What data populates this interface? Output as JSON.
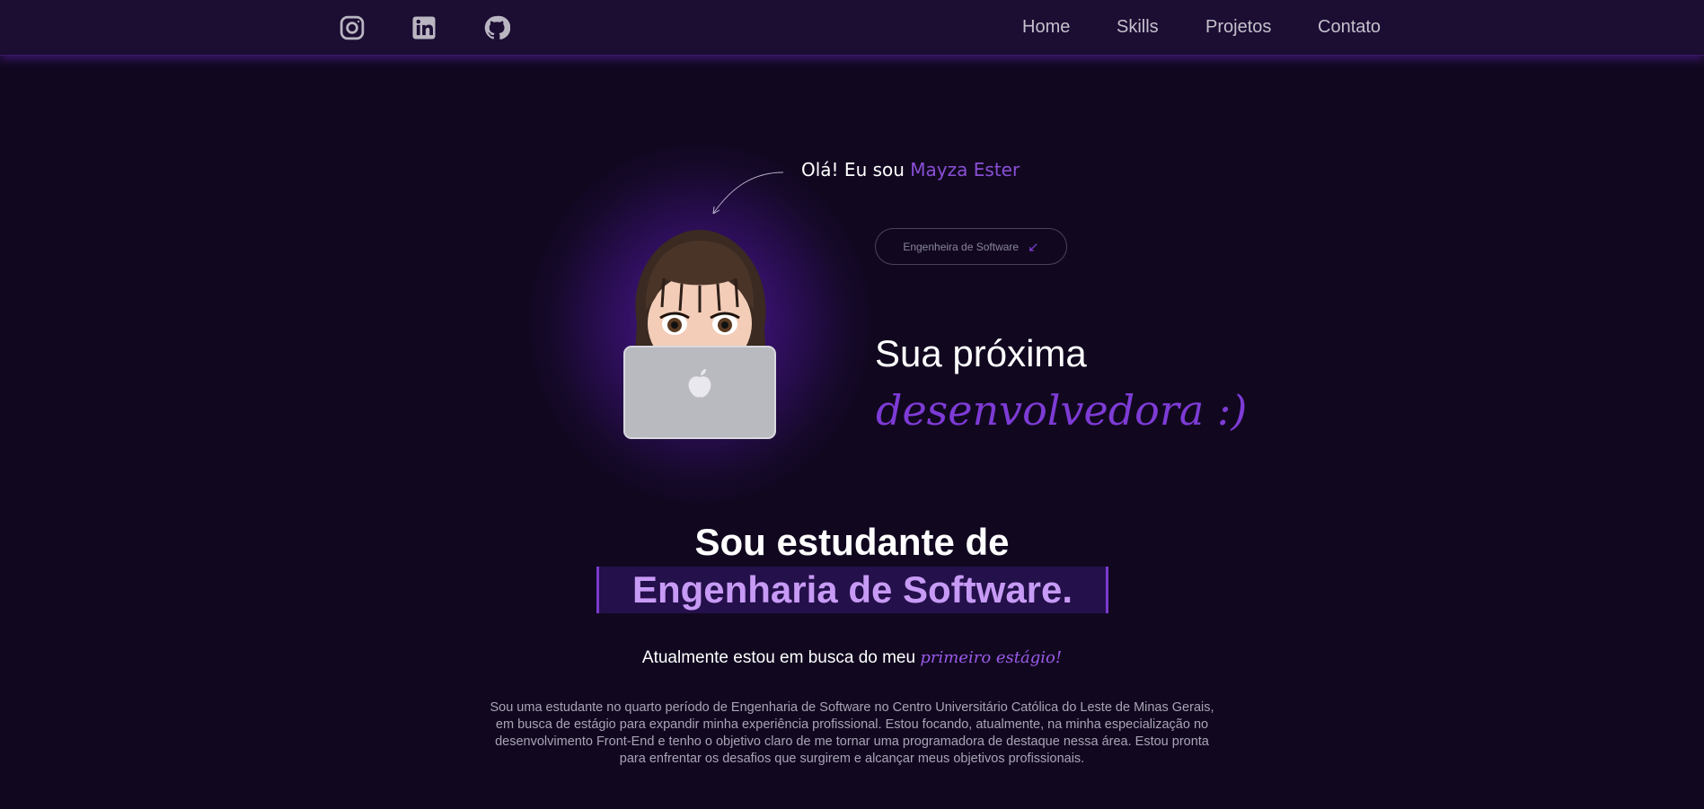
{
  "nav": {
    "social": [
      {
        "icon": "instagram-icon"
      },
      {
        "icon": "linkedin-icon"
      },
      {
        "icon": "github-icon"
      }
    ],
    "links": [
      "Home",
      "Skills",
      "Projetos",
      "Contato"
    ]
  },
  "hero": {
    "greeting_prefix": "Olá! Eu sou",
    "greeting_name": "Mayza Ester",
    "role_pill": "Engenheira de Software",
    "role_pill_icon": "arrow-down-left-icon",
    "tagline_line1": "Sua próxima",
    "tagline_line2": "desenvolvedora :)"
  },
  "intro": {
    "heading_line1": "Sou estudante de",
    "heading_line2": "Engenharia de Software.",
    "search_prefix": "Atualmente estou em busca do meu",
    "search_highlight": "primeiro estágio!",
    "bio_lines": [
      "Sou uma estudante no quarto período de Engenharia de Software no Centro Universitário Católica do Leste de Minas Gerais,",
      "em busca de estágio para expandir minha experiência profissional. Estou focando, atualmente, na minha especialização no",
      "desenvolvimento Front-End e tenho o objetivo claro de me tornar uma programadora de destaque nessa área. Estou pronta",
      "para enfrentar os desafios que surgirem e alcançar meus objetivos profissionais."
    ]
  },
  "colors": {
    "background": "#110820",
    "navbar": "#1c0d33",
    "accent": "#7e3bd6",
    "accent_light": "#c79bf5"
  }
}
